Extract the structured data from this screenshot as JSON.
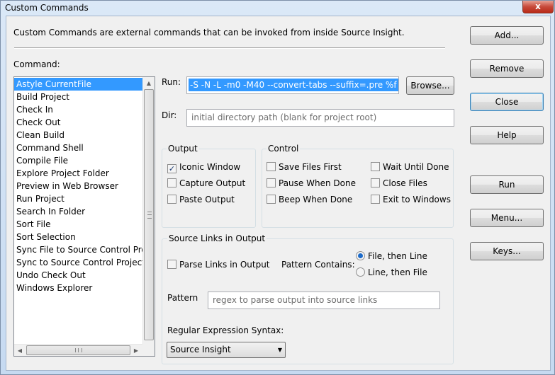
{
  "window": {
    "title": "Custom Commands",
    "close_glyph": "x"
  },
  "description": "Custom Commands are external commands that can be invoked from inside Source Insight.",
  "command_label": "Command:",
  "commands": [
    "Astyle CurrentFile",
    "Build Project",
    "Check In",
    "Check Out",
    "Clean Build",
    "Command Shell",
    "Compile File",
    "Explore Project Folder",
    "Preview in Web Browser",
    "Run Project",
    "Search In Folder",
    "Sort File",
    "Sort Selection",
    "Sync File to Source Control Project",
    "Sync to Source Control Project",
    "Undo Check Out",
    "Windows Explorer"
  ],
  "selected_command": "Astyle CurrentFile",
  "run": {
    "label": "Run:",
    "value": "-S -N -L -m0 -M40 --convert-tabs --suffix=.pre %f"
  },
  "dir": {
    "label": "Dir:",
    "placeholder": "initial directory path (blank for project root)"
  },
  "browse_label": "Browse...",
  "output": {
    "title": "Output",
    "iconic_window": {
      "label": "Iconic Window",
      "checked": true
    },
    "capture_output": {
      "label": "Capture Output",
      "checked": false
    },
    "paste_output": {
      "label": "Paste Output",
      "checked": false
    }
  },
  "control": {
    "title": "Control",
    "save_files_first": {
      "label": "Save Files First",
      "checked": false
    },
    "pause_when_done": {
      "label": "Pause When Done",
      "checked": false
    },
    "beep_when_done": {
      "label": "Beep When Done",
      "checked": false
    },
    "wait_until_done": {
      "label": "Wait Until Done",
      "checked": false
    },
    "close_files": {
      "label": "Close Files",
      "checked": false
    },
    "exit_to_windows": {
      "label": "Exit to Windows",
      "checked": false
    }
  },
  "source_links": {
    "title": "Source Links in Output",
    "parse_links": {
      "label": "Parse Links in Output",
      "checked": false
    },
    "pattern_contains_label": "Pattern Contains:",
    "file_then_line": {
      "label": "File, then Line",
      "selected": true
    },
    "line_then_file": {
      "label": "Line, then File",
      "selected": false
    },
    "pattern_label": "Pattern",
    "pattern_placeholder": "regex to parse output into source links",
    "regex_syntax_label": "Regular Expression Syntax:",
    "regex_syntax_value": "Source Insight"
  },
  "buttons": {
    "add": "Add...",
    "remove": "Remove",
    "close": "Close",
    "help": "Help",
    "run": "Run",
    "menu": "Menu...",
    "keys": "Keys..."
  },
  "colors": {
    "selection": "#3399ff",
    "window_frame": "#c6daf1",
    "dialog_bg": "#f0f0f0"
  }
}
